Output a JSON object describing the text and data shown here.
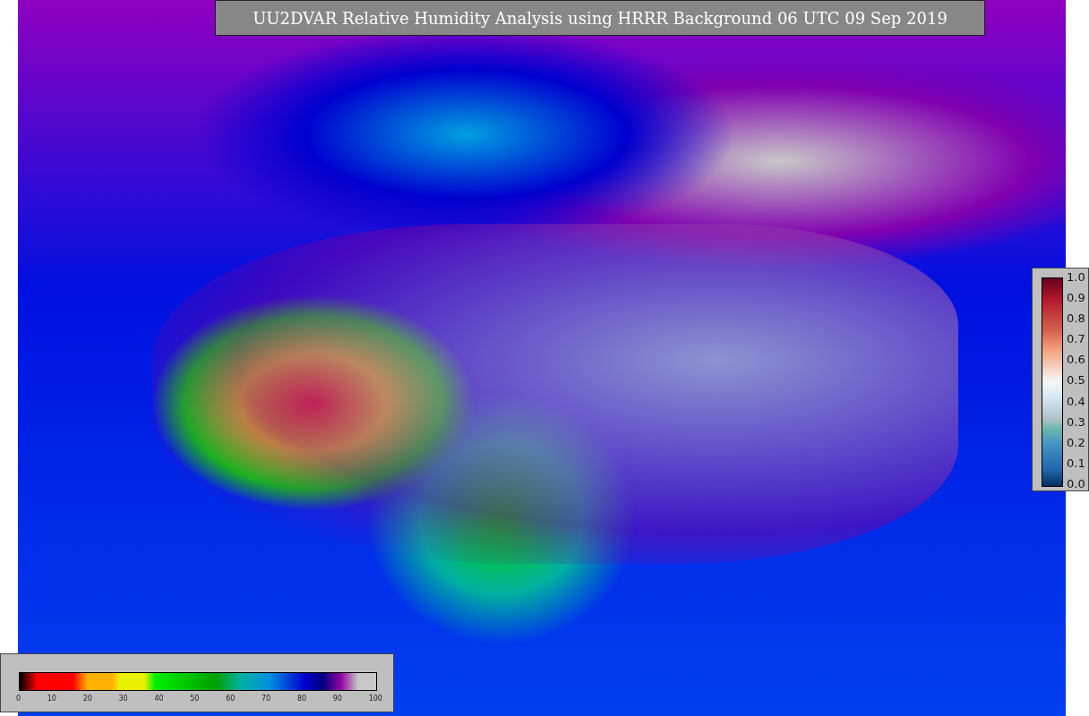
{
  "title": "UU2DVAR Relative Humidity Analysis using HRRR Background 06 UTC 09 Sep 2019",
  "humidity_colorbar": {
    "ticks": [
      "0",
      "10",
      "20",
      "30",
      "40",
      "50",
      "60",
      "70",
      "80",
      "90",
      "100"
    ]
  },
  "ratio_colorbar": {
    "ticks": [
      "1.0",
      "0.9",
      "0.8",
      "0.7",
      "0.6",
      "0.5",
      "0.4",
      "0.3",
      "0.2",
      "0.1",
      "0.0"
    ]
  }
}
